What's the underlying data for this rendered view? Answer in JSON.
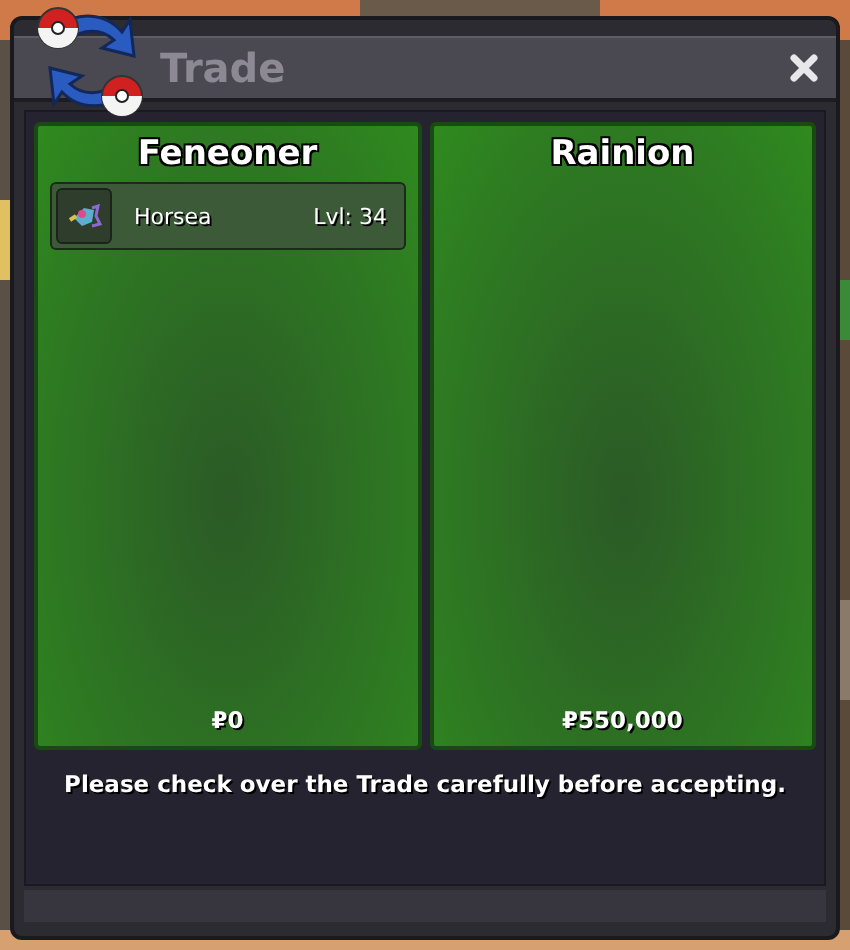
{
  "window": {
    "title": "Trade"
  },
  "panels": [
    {
      "name": "Feneoner",
      "items": [
        {
          "name": "Horsea",
          "level_text": "Lvl: 34"
        }
      ],
      "money": "₽0"
    },
    {
      "name": "Rainion",
      "money": "₽550,000"
    }
  ],
  "message": "Please check over the Trade carefully before accepting."
}
